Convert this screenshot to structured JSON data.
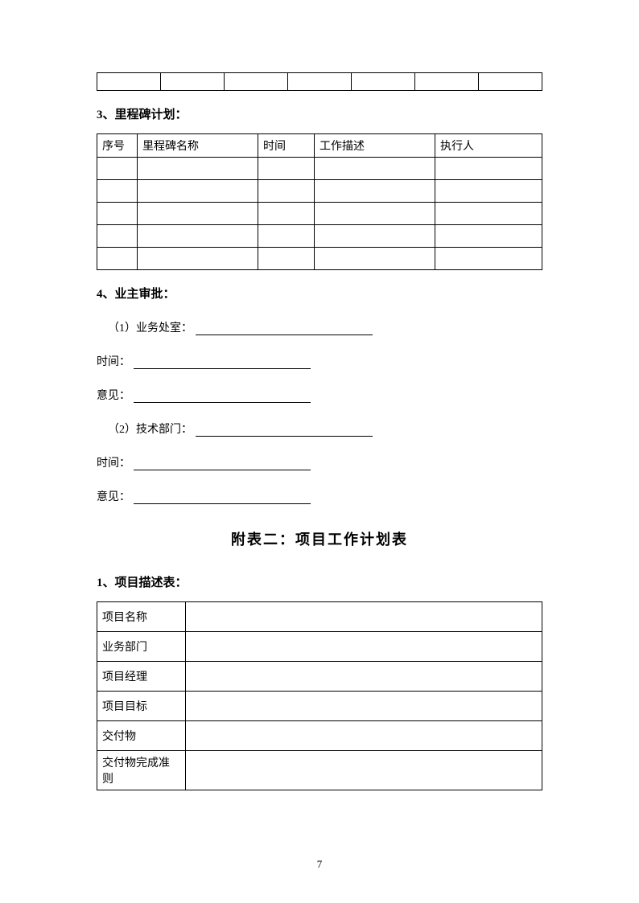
{
  "table1_cols": 7,
  "section3_heading": "3、里程碑计划：",
  "milestone_headers": [
    "序号",
    "里程碑名称",
    "时间",
    "工作描述",
    "执行人"
  ],
  "milestone_rows": 5,
  "section4_heading": "4、业主审批：",
  "approval": {
    "item1": "（1）业务处室：",
    "time_label": "时间：",
    "opinion_label": "意见：",
    "item2": "（2）技术部门："
  },
  "appendix_title": "附表二：项目工作计划表",
  "section1_heading": "1、项目描述表：",
  "desc_rows": [
    "项目名称",
    "业务部门",
    "项目经理",
    "项目目标",
    "交付物",
    "交付物完成准则"
  ],
  "page_number": "7"
}
